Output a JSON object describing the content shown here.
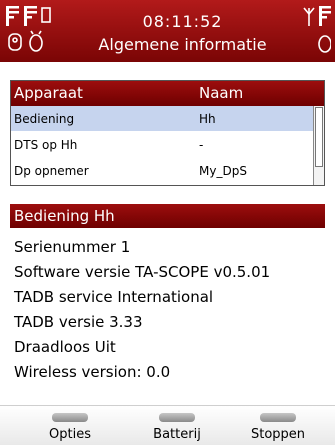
{
  "header": {
    "time": "08:11:52",
    "title": "Algemene informatie"
  },
  "table": {
    "columns": [
      "Apparaat",
      "Naam"
    ],
    "rows": [
      {
        "device": "Bediening",
        "name": "Hh",
        "selected": true
      },
      {
        "device": "DTS op Hh",
        "name": "-",
        "selected": false
      },
      {
        "device": "Dp opnemer",
        "name": "My_DpS",
        "selected": false
      }
    ]
  },
  "details": {
    "header": "Bediening Hh",
    "lines": [
      "Serienummer 1",
      "Software versie TA-SCOPE v0.5.01",
      "TADB service International",
      "TADB versie 3.33",
      "Draadloos Uit",
      "Wireless version: 0.0"
    ]
  },
  "softkeys": [
    "Opties",
    "Batterij",
    "Stoppen"
  ],
  "colors": {
    "header_red": "#9d0e0e",
    "selection": "#c6d4ee"
  }
}
